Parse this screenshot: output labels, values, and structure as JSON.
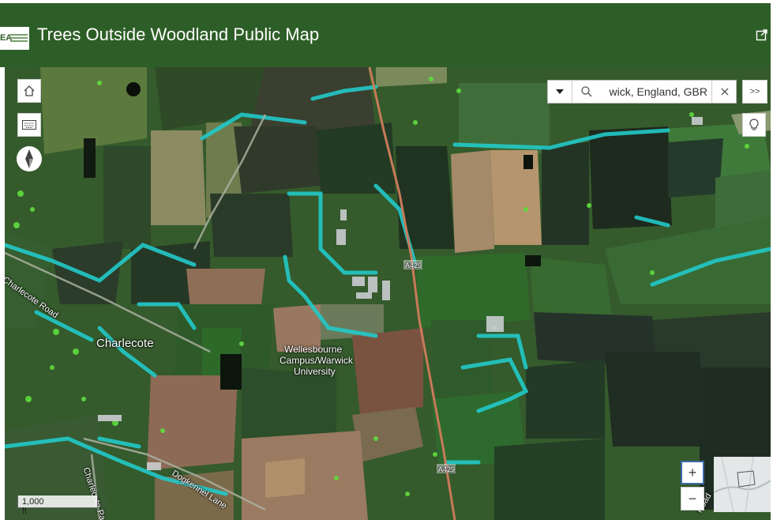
{
  "header": {
    "title": "Trees Outside Woodland Public Map",
    "logo_text": "EA"
  },
  "search": {
    "value": "wick, England, GBR"
  },
  "map": {
    "place_labels": {
      "charlecote": "Charlecote",
      "campus_line1": "Wellesbourne",
      "campus_line2": "Campus/Warwick",
      "campus_line3": "University"
    },
    "road_labels": {
      "charlecote_road": "Charlecote Road",
      "dogkennel_lane": "Dogkennel Lane",
      "charlecote_park": "Charlecote Pa",
      "a429_top": "A429",
      "a429_bottom": "A429",
      "edge_road": "Road"
    },
    "scale_label": "1,000 ft"
  },
  "controls": {
    "zoom_in": "+",
    "zoom_out": "−",
    "expand_label": ">>"
  },
  "colors": {
    "header": "#2e5e27",
    "tree_cyan": "#22c9c9",
    "tree_green": "#5fdc3e"
  }
}
